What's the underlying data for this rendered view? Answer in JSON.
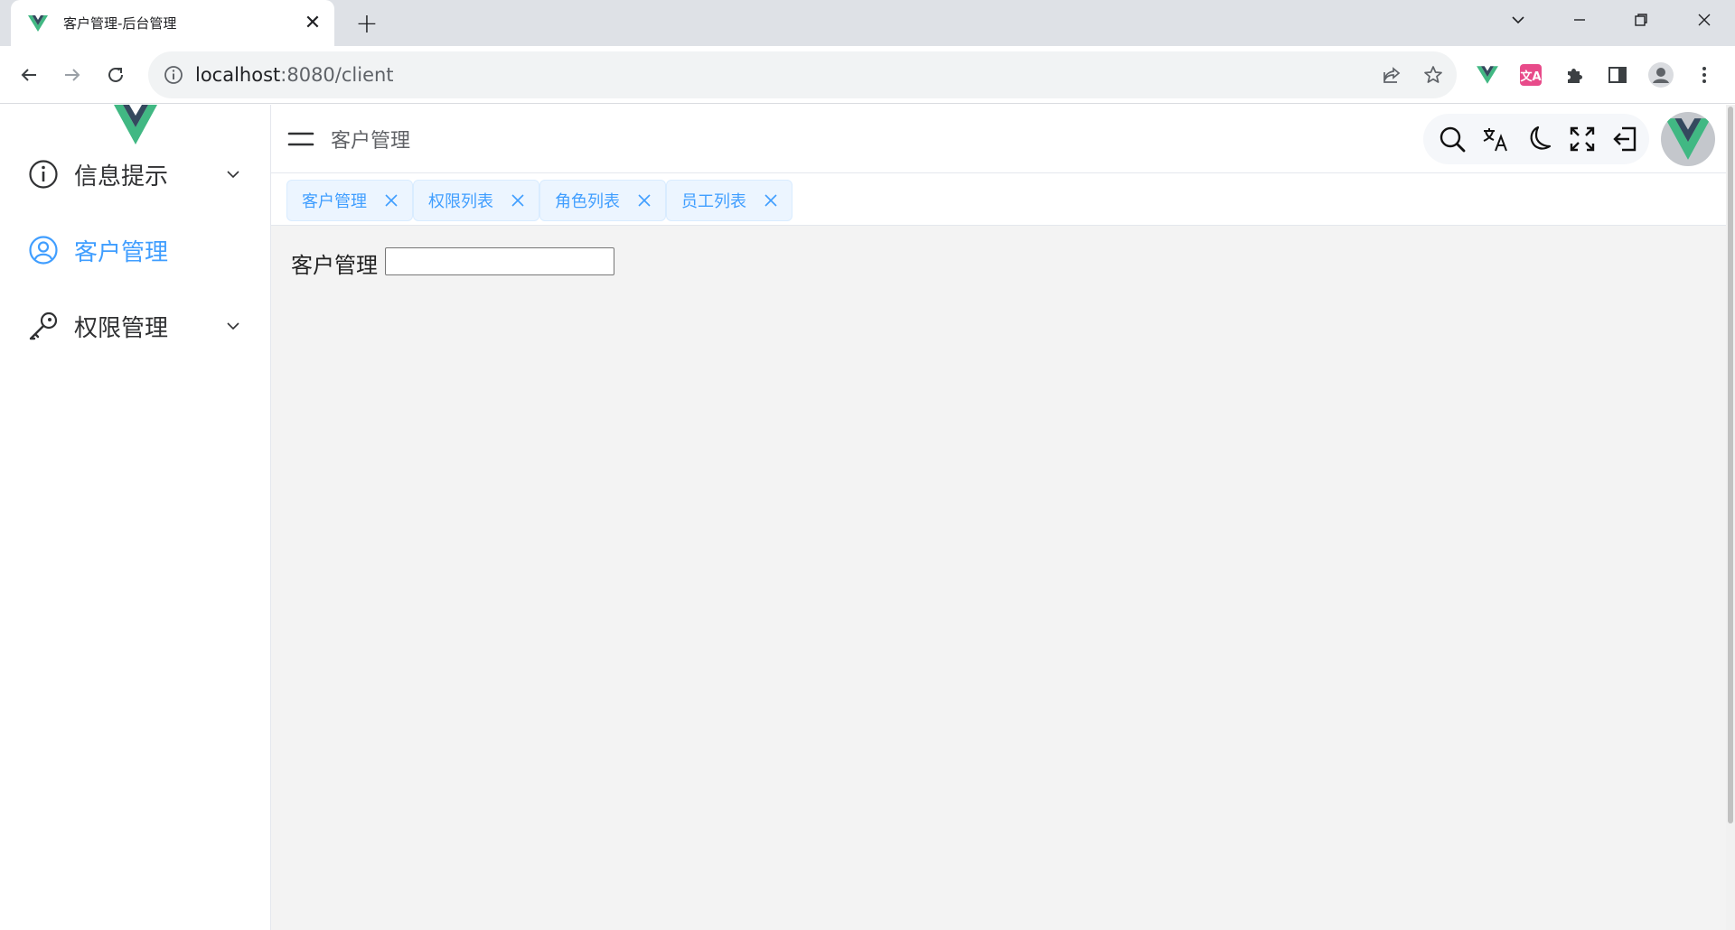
{
  "browser": {
    "tab_title": "客户管理-后台管理",
    "url_host": "localhost",
    "url_rest": ":8080/client"
  },
  "sidebar": {
    "items": [
      {
        "label": "信息提示",
        "icon": "info-icon",
        "expandable": true,
        "active": false
      },
      {
        "label": "客户管理",
        "icon": "user-icon",
        "expandable": false,
        "active": true
      },
      {
        "label": "权限管理",
        "icon": "key-icon",
        "expandable": true,
        "active": false
      }
    ]
  },
  "header": {
    "breadcrumb": "客户管理",
    "tools": [
      "search-icon",
      "translate-icon",
      "moon-icon",
      "fullscreen-icon",
      "logout-icon"
    ]
  },
  "tags": [
    {
      "label": "客户管理"
    },
    {
      "label": "权限列表"
    },
    {
      "label": "角色列表"
    },
    {
      "label": "员工列表"
    }
  ],
  "main": {
    "field_label": "客户管理",
    "field_value": ""
  },
  "colors": {
    "accent": "#409eff",
    "vue_green": "#41b883",
    "vue_dark": "#34495e"
  }
}
